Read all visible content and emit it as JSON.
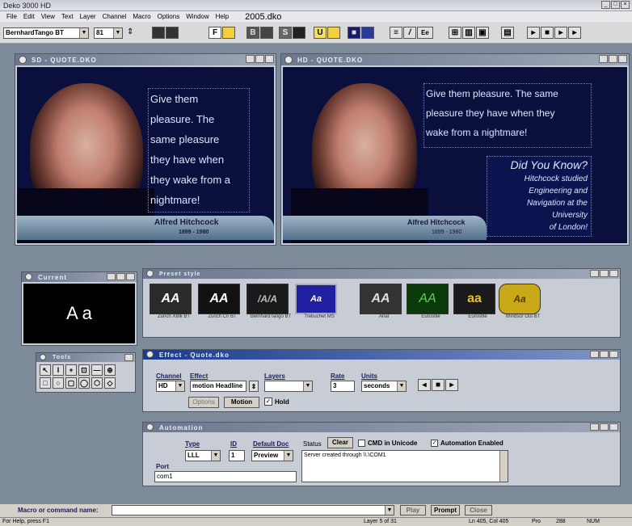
{
  "app": {
    "title": "Deko 3000 HD",
    "doc_name": "2005.dko"
  },
  "menu": [
    "File",
    "Edit",
    "View",
    "Text",
    "Layer",
    "Channel",
    "Macro",
    "Options",
    "Window",
    "Help"
  ],
  "toolbar": {
    "font_value": "BernhardTango BT",
    "size_value": "81",
    "buttons": [
      "F",
      "B",
      "U",
      "Ee"
    ]
  },
  "sd_window": {
    "title": "SD - QUOTE.DKO",
    "quote_lines": [
      "Give them",
      "pleasure. The",
      "same pleasure",
      "they have when",
      "they wake from a",
      "nightmare!"
    ],
    "name": "Alfred Hitchcock",
    "dates": "1899 - 1980"
  },
  "hd_window": {
    "title": "HD - QUOTE.DKO",
    "quote_lines": [
      "Give them pleasure. The same",
      "pleasure they have when they",
      "wake from a nightmare!"
    ],
    "did_title": "Did You Know?",
    "did_lines": [
      "Hitchcock studied",
      "Engineering and",
      "Navigation at the",
      "University",
      "of London!"
    ],
    "name": "Alfred Hitchcock",
    "dates": "1899 - 1980"
  },
  "preview_window": {
    "title": "Current",
    "sample": "A a"
  },
  "preset_window": {
    "title": "Preset style",
    "presets": [
      {
        "label": "Zurich XBlk BT",
        "glyph": "AA",
        "bg": "#2a2a2a",
        "fg": "#ffffff"
      },
      {
        "label": "Zurich Cn BT",
        "glyph": "AA",
        "bg": "#111111",
        "fg": "#ffffff"
      },
      {
        "label": "BernhardTango BT",
        "glyph": "/A/A",
        "bg": "#1a1a1a",
        "fg": "#bbbbbb"
      },
      {
        "label": "Trebuchet MS",
        "glyph": "Aa",
        "bg": "#2020a0",
        "fg": "#ffffff"
      },
      {
        "label": "Arial",
        "glyph": "AA",
        "bg": "#333333",
        "fg": "#dddddd"
      },
      {
        "label": "Eurostile",
        "glyph": "AA",
        "bg": "#0a3a0a",
        "fg": "#66cc66"
      },
      {
        "label": "Eurostile",
        "glyph": "aa",
        "bg": "#1a1a1a",
        "fg": "#f0c020"
      },
      {
        "label": "Windsor Out BT",
        "glyph": "Aa",
        "bg": "#c9a818",
        "fg": "#4a3a08"
      }
    ]
  },
  "tools_window": {
    "title": "Tools"
  },
  "effect_window": {
    "title": "Effect - Quote.dko",
    "channel_label": "Channel",
    "channel_value": "HD",
    "effect_label": "Effect",
    "effect_value": "motion Headline",
    "layers_label": "Layers",
    "layers_value": "",
    "rate_label": "Rate",
    "rate_value": "3",
    "units_label": "Units",
    "units_value": "seconds",
    "options_btn": "Options",
    "motion_btn": "Motion",
    "hold_label": "Hold"
  },
  "automation_window": {
    "title": "Automation",
    "type_label": "Type",
    "type_value": "LLL",
    "id_label": "ID",
    "id_value": "1",
    "default_doc_label": "Default Doc",
    "default_doc_value": "Preview",
    "status_label": "Status",
    "clear_btn": "Clear",
    "cmd_label": "CMD in Unicode",
    "auto_enabled_label": "Automation Enabled",
    "port_label": "Port",
    "port_value": "com1",
    "log_text": "Server created through \\\\.\\COM1"
  },
  "command_bar": {
    "label": "Macro or command name:",
    "play_btn": "Play",
    "prompt_btn": "Prompt",
    "close_btn": "Close"
  },
  "status_bar": {
    "help": "For Help, press F1",
    "layer": "Layer 5 of 31",
    "position": "Ln 405, Col 405",
    "pos2": "Pro",
    "num": "288",
    "caps": "NUM"
  },
  "colors": {
    "mdi_bg": "#7d8a9a",
    "video_bg": "#0a0f3c",
    "title_blue": "#1a3a8a"
  }
}
